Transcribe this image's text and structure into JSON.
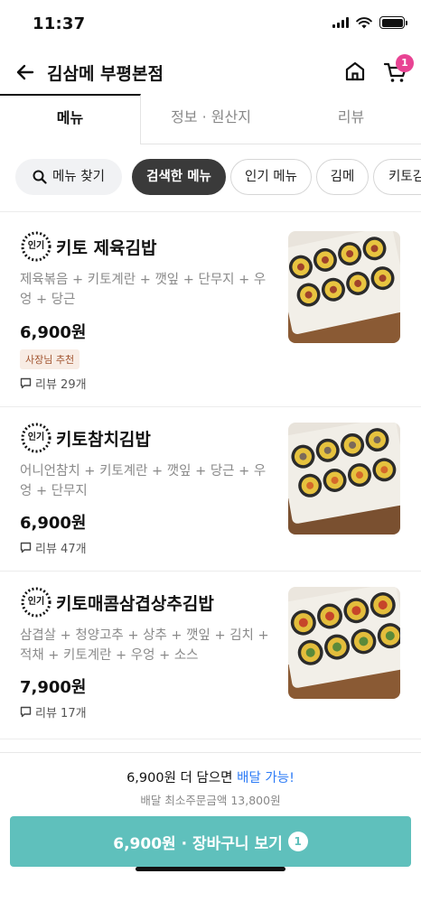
{
  "status": {
    "time": "11:37"
  },
  "header": {
    "title": "김삼메 부평본점",
    "cart_count": "1"
  },
  "tabs": [
    {
      "label": "메뉴"
    },
    {
      "label": "정보 · 원산지"
    },
    {
      "label": "리뷰"
    }
  ],
  "chips": [
    {
      "label": "메뉴 찾기"
    },
    {
      "label": "검색한 메뉴"
    },
    {
      "label": "인기 메뉴"
    },
    {
      "label": "김메"
    },
    {
      "label": "키토김"
    }
  ],
  "popular_badge": "인기",
  "menu": [
    {
      "name": "키토 제육김밥",
      "desc": "제육볶음 + 키토계란 + 깻잎 + 단무지 + 우엉 + 당근",
      "price": "6,900원",
      "tag": "사장님 추천",
      "reviews": "리뷰 29개"
    },
    {
      "name": "키토참치김밥",
      "desc": "어니언참치 + 키토계란 + 깻잎 + 당근 + 우엉 + 단무지",
      "price": "6,900원",
      "reviews": "리뷰 47개"
    },
    {
      "name": "키토매콤삼겹상추김밥",
      "desc": "삼겹살 + 청양고추 + 상추 + 깻잎 + 김치 + 적채 + 키토계란 + 우엉 + 소스",
      "price": "7,900원",
      "reviews": "리뷰 17개"
    }
  ],
  "bottom": {
    "add_more_prefix": "6,900원 더 담으면 ",
    "add_more_accent": "배달 가능!",
    "min_order": "배달 최소주문금액 13,800원",
    "cta_label": "6,900원 · 장바구니 보기",
    "cta_count": "1"
  },
  "colors": {
    "accent": "#5fc0bc",
    "badge": "#e84393",
    "link": "#2e7cf6"
  }
}
